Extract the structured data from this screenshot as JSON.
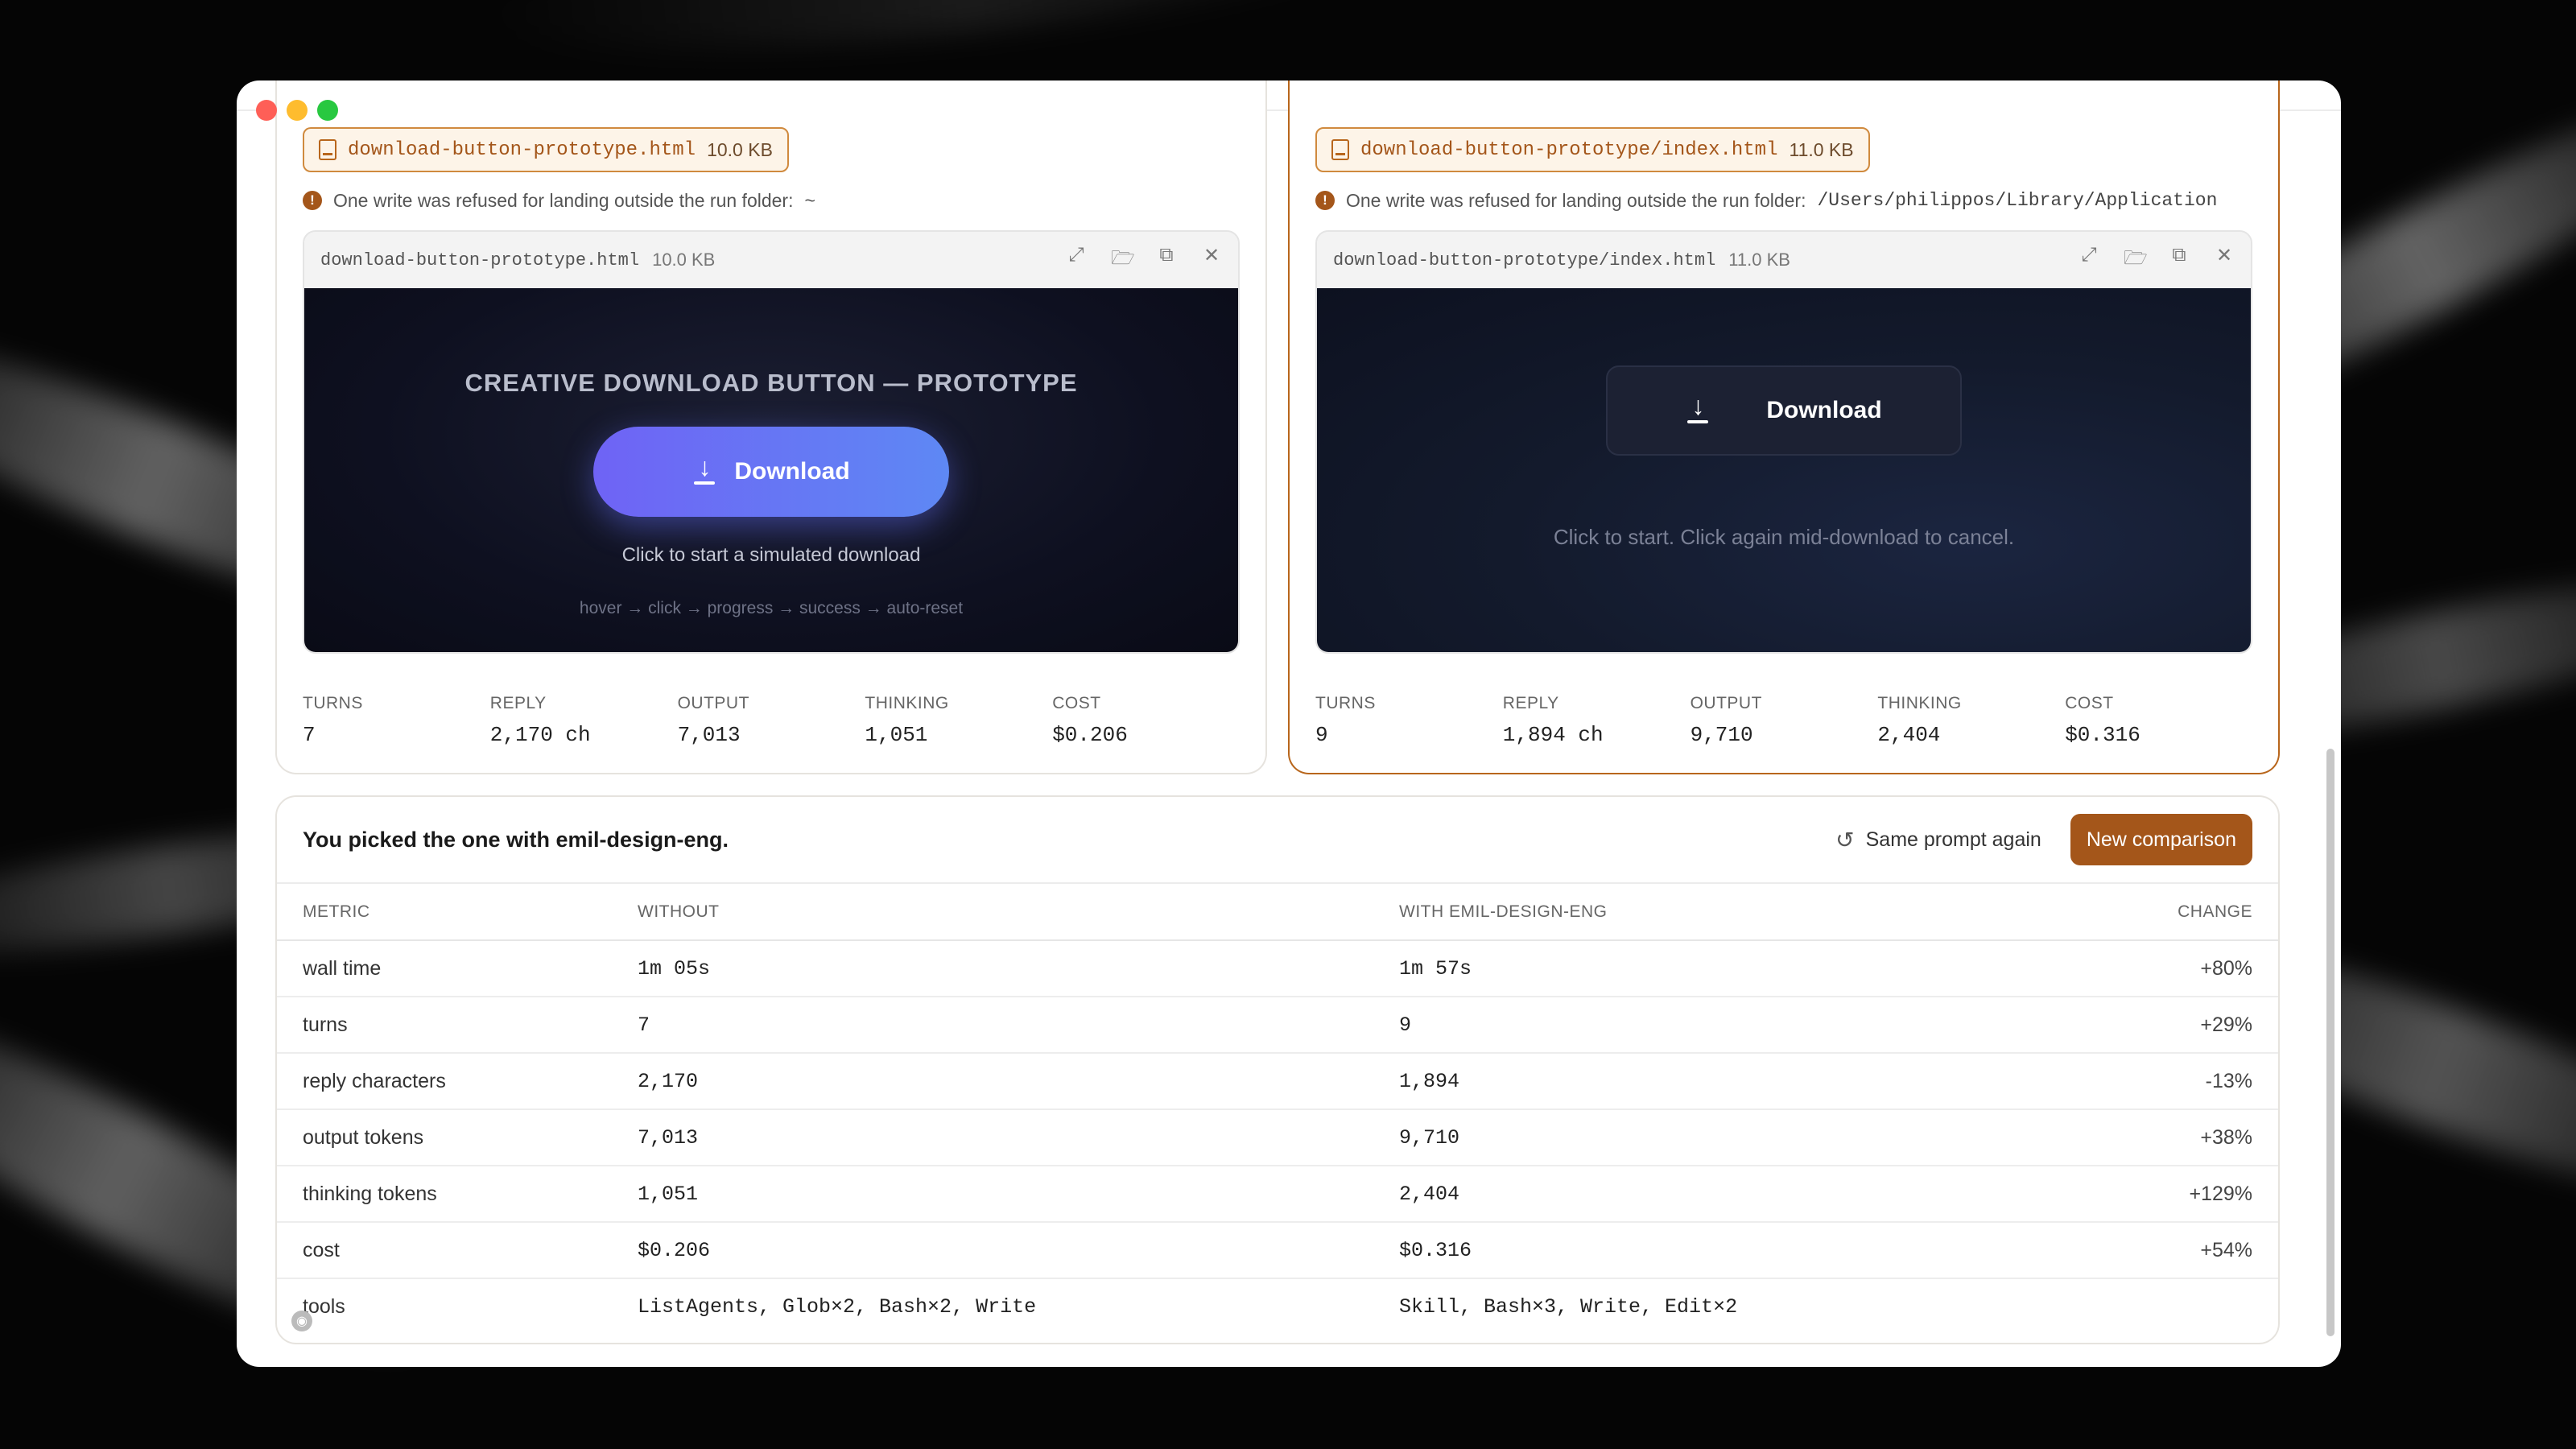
{
  "left": {
    "file_chip": {
      "name": "download-button-prototype.html",
      "size": "10.0 KB"
    },
    "warning": {
      "text": "One write was refused for landing outside the run folder:",
      "path": "~"
    },
    "preview": {
      "name": "download-button-prototype.html",
      "size": "10.0 KB",
      "title": "CREATIVE DOWNLOAD BUTTON — PROTOTYPE",
      "button_label": "Download",
      "subtitle": "Click to start a simulated download",
      "flow": "hover → click → progress → success → auto-reset"
    },
    "stats": [
      {
        "label": "TURNS",
        "value": "7"
      },
      {
        "label": "REPLY",
        "value": "2,170 ch"
      },
      {
        "label": "OUTPUT",
        "value": "7,013"
      },
      {
        "label": "THINKING",
        "value": "1,051"
      },
      {
        "label": "COST",
        "value": "$0.206"
      }
    ]
  },
  "right": {
    "file_chip": {
      "name": "download-button-prototype/index.html",
      "size": "11.0 KB"
    },
    "warning": {
      "text": "One write was refused for landing outside the run folder:",
      "path": "/Users/philippos/Library/Application"
    },
    "preview": {
      "name": "download-button-prototype/index.html",
      "size": "11.0 KB",
      "button_label": "Download",
      "subtitle": "Click to start. Click again mid-download to cancel."
    },
    "stats": [
      {
        "label": "TURNS",
        "value": "9"
      },
      {
        "label": "REPLY",
        "value": "1,894 ch"
      },
      {
        "label": "OUTPUT",
        "value": "9,710"
      },
      {
        "label": "THINKING",
        "value": "2,404"
      },
      {
        "label": "COST",
        "value": "$0.316"
      }
    ]
  },
  "results": {
    "title": "You picked the one with emil-design-eng.",
    "same_prompt_label": "Same prompt again",
    "new_comparison_label": "New comparison",
    "columns": [
      "METRIC",
      "WITHOUT",
      "WITH EMIL-DESIGN-ENG",
      "CHANGE"
    ],
    "rows": [
      {
        "metric": "wall time",
        "without": "1m 05s",
        "with": "1m 57s",
        "change": "+80%"
      },
      {
        "metric": "turns",
        "without": "7",
        "with": "9",
        "change": "+29%"
      },
      {
        "metric": "reply characters",
        "without": "2,170",
        "with": "1,894",
        "change": "-13%"
      },
      {
        "metric": "output tokens",
        "without": "7,013",
        "with": "9,710",
        "change": "+38%"
      },
      {
        "metric": "thinking tokens",
        "without": "1,051",
        "with": "2,404",
        "change": "+129%"
      },
      {
        "metric": "cost",
        "without": "$0.206",
        "with": "$0.316",
        "change": "+54%"
      },
      {
        "metric": "tools",
        "without": "ListAgents, Glob×2, Bash×2, Write",
        "with": "Skill, Bash×3, Write, Edit×2",
        "change": ""
      }
    ]
  },
  "icons": {
    "expand": "expand-icon",
    "folder": "folder-icon",
    "open_external": "open-external-icon",
    "close": "close-icon",
    "theme": "sun-icon",
    "history": "history-icon"
  },
  "colors": {
    "accent": "#a4561a",
    "selected_border": "#b8661c",
    "button_gradient_start": "#6f63f5",
    "button_gradient_end": "#5e88f4"
  }
}
